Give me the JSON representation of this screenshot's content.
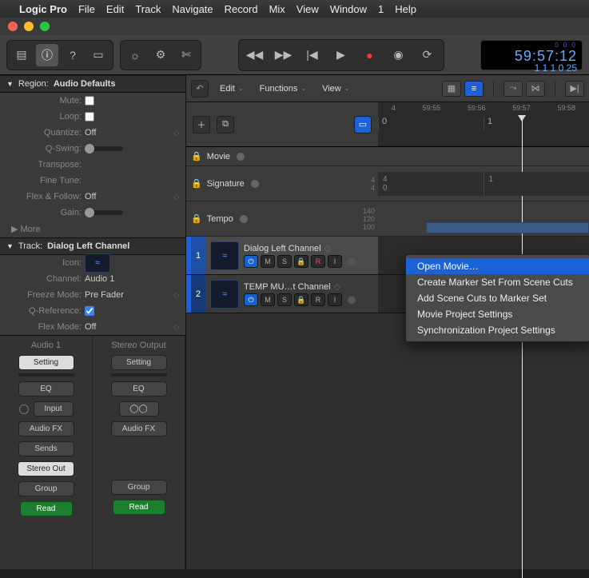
{
  "menubar": {
    "app": "Logic Pro",
    "items": [
      "File",
      "Edit",
      "Track",
      "Navigate",
      "Record",
      "Mix",
      "View",
      "Window",
      "1",
      "Help"
    ]
  },
  "lcd": {
    "top": "0 0 0",
    "time": "59:57:12",
    "bottom": "1  1  1  0 25"
  },
  "tracks_toolbar": {
    "edit": "Edit",
    "functions": "Functions",
    "view": "View"
  },
  "timebar": {
    "labels": [
      "4",
      "59:55",
      "59:56",
      "59:57",
      "59:58"
    ],
    "bars": [
      "0",
      "1"
    ]
  },
  "region": {
    "header_label": "Region:",
    "header_value": "Audio Defaults",
    "mute": "Mute:",
    "loop": "Loop:",
    "quantize_k": "Quantize:",
    "quantize_v": "Off",
    "qswing": "Q-Swing:",
    "transpose": "Transpose:",
    "finetune": "Fine Tune:",
    "flexfollow_k": "Flex & Follow:",
    "flexfollow_v": "Off",
    "gain": "Gain:",
    "more": "More"
  },
  "track": {
    "header_label": "Track:",
    "header_value": "Dialog Left Channel",
    "icon_k": "Icon:",
    "channel_k": "Channel:",
    "channel_v": "Audio 1",
    "freeze_k": "Freeze Mode:",
    "freeze_v": "Pre Fader",
    "qref_k": "Q-Reference:",
    "flexmode_k": "Flex Mode:",
    "flexmode_v": "Off"
  },
  "strips": {
    "a_name": "Audio 1",
    "b_name": "Stereo Output",
    "setting": "Setting",
    "eq": "EQ",
    "input": "Input",
    "audiofx": "Audio FX",
    "sends": "Sends",
    "stereo_out": "Stereo Out",
    "group": "Group",
    "read": "Read"
  },
  "global": {
    "movie": "Movie",
    "signature": "Signature",
    "tempo": "Tempo",
    "sig_top": "4",
    "sig_bot": "4",
    "sig_cell_top": "4",
    "sig_cell_bot": "0",
    "sig_cell_right": "1",
    "tempo_top": "140",
    "tempo_mid": "120",
    "tempo_bot": "100"
  },
  "tracks": {
    "t1": "Dialog Left Channel",
    "t2": "TEMP MU…t Channel",
    "m": "M",
    "s": "S",
    "r": "R",
    "i": "I",
    "num1": "1",
    "num2": "2"
  },
  "ctx": {
    "open": "Open Movie…",
    "marker": "Create Marker Set From Scene Cuts",
    "addscene": "Add Scene Cuts to Marker Set",
    "proj": "Movie Project Settings",
    "sync": "Synchronization Project Settings"
  }
}
